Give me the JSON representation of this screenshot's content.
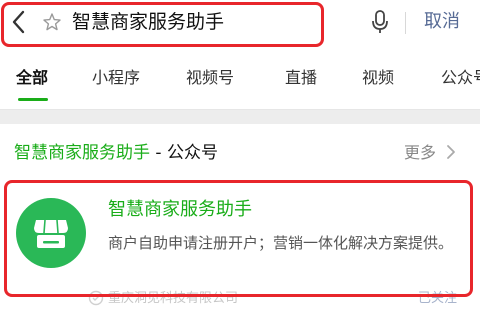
{
  "search": {
    "query": "智慧商家服务助手",
    "cancel_label": "取消"
  },
  "tabs": [
    {
      "label": "全部"
    },
    {
      "label": "小程序"
    },
    {
      "label": "视频号"
    },
    {
      "label": "直播"
    },
    {
      "label": "视频"
    },
    {
      "label": "公众号"
    }
  ],
  "section": {
    "title_highlight": "智慧商家服务助手",
    "title_suffix": " - 公众号",
    "more_label": "更多"
  },
  "result": {
    "name": "智慧商家服务助手",
    "description": "商户自助申请注册开户；营销一体化解决方案提供。",
    "company": "重庆洞见科技有限公司",
    "follow_status": "已关注"
  },
  "colors": {
    "accent_green": "#1aad19",
    "avatar_green": "#2ab857",
    "highlight_red": "#e8262b",
    "link_blue": "#576b95"
  },
  "icons": {
    "back": "chevron-left-icon",
    "star": "star-outline-icon",
    "mic": "microphone-icon",
    "more": "chevron-right-icon",
    "avatar": "storefront-icon"
  }
}
